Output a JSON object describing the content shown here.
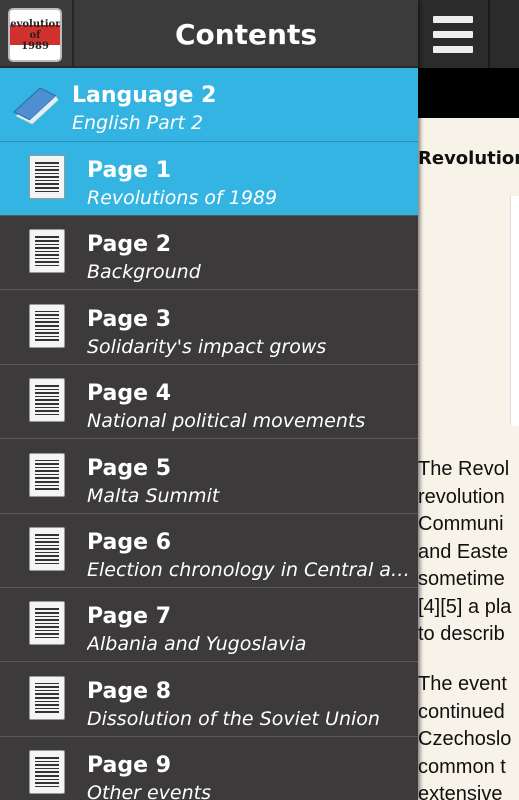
{
  "header": {
    "title": "Contents",
    "app_icon_text": "Revolutions\nof\n1989"
  },
  "group": {
    "title": "Language 2",
    "subtitle": "English Part 2"
  },
  "items": [
    {
      "title": "Page 1",
      "subtitle": "Revolutions of 1989",
      "selected": true
    },
    {
      "title": "Page 2",
      "subtitle": "Background"
    },
    {
      "title": "Page 3",
      "subtitle": "Solidarity's impact grows"
    },
    {
      "title": "Page 4",
      "subtitle": "National political movements"
    },
    {
      "title": "Page 5",
      "subtitle": "Malta Summit"
    },
    {
      "title": "Page 6",
      "subtitle": "Election chronology in Central and Eastern Europe"
    },
    {
      "title": "Page 7",
      "subtitle": "Albania and Yugoslavia"
    },
    {
      "title": "Page 8",
      "subtitle": "Dissolution of the Soviet Union"
    },
    {
      "title": "Page 9",
      "subtitle": "Other events"
    }
  ],
  "content": {
    "article_title": "Revolution",
    "para1": "The Revol\nrevolution\nCommuni\nand Easte\nsometime\n[4][5] a pla\nto describ",
    "para2": "The event\ncontinued\nCzechoslo\ncommon t\nextensive"
  },
  "colors": {
    "accent": "#34b4e3",
    "drawer_bg": "#3c3a3a"
  },
  "icons": {
    "menu": "hamburger-menu-icon",
    "group": "book-icon",
    "item": "document-icon"
  }
}
